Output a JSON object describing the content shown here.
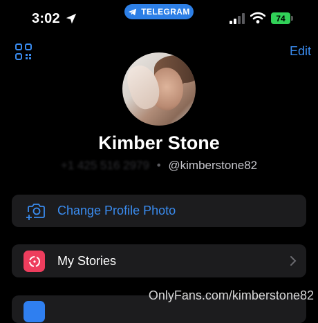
{
  "status_bar": {
    "time": "3:02",
    "app_pill": "TELEGRAM",
    "battery": "74"
  },
  "nav": {
    "edit_label": "Edit"
  },
  "profile": {
    "name": "Kimber Stone",
    "phone": "+1 425 516 2979",
    "separator": "•",
    "username": "@kimberstone82"
  },
  "menu": {
    "change_photo_label": "Change Profile Photo",
    "my_stories_label": "My Stories"
  },
  "watermark": "OnlyFans.com/kimberstone82",
  "colors": {
    "accent": "#3a8cf0",
    "pill": "#2d7fe6",
    "battery": "#31d158",
    "stories_icon": "#ee3d5d",
    "card_bg": "#1c1c1e"
  }
}
